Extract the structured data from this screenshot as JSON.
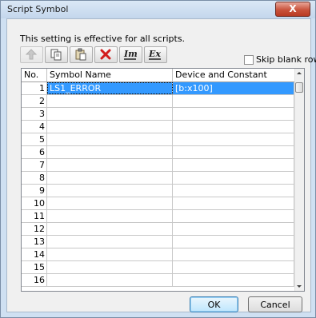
{
  "window": {
    "title": "Script Symbol",
    "close_glyph": "X"
  },
  "hint": "This setting is effective for all scripts.",
  "toolbar": {
    "buttons": [
      {
        "name": "add-row-icon",
        "enabled": false
      },
      {
        "name": "copy-icon",
        "enabled": true
      },
      {
        "name": "paste-icon",
        "enabled": true
      },
      {
        "name": "delete-icon",
        "enabled": true
      },
      {
        "name": "import-icon",
        "enabled": true
      },
      {
        "name": "export-icon",
        "enabled": true
      }
    ]
  },
  "skip_blank_rows": {
    "label": "Skip blank rows",
    "checked": false
  },
  "table": {
    "columns": [
      "No.",
      "Symbol Name",
      "Device and Constant"
    ],
    "rows": [
      {
        "no": "1",
        "symbol": "LS1_ERROR",
        "device": "[b:x100]"
      },
      {
        "no": "2",
        "symbol": "",
        "device": ""
      },
      {
        "no": "3",
        "symbol": "",
        "device": ""
      },
      {
        "no": "4",
        "symbol": "",
        "device": ""
      },
      {
        "no": "5",
        "symbol": "",
        "device": ""
      },
      {
        "no": "6",
        "symbol": "",
        "device": ""
      },
      {
        "no": "7",
        "symbol": "",
        "device": ""
      },
      {
        "no": "8",
        "symbol": "",
        "device": ""
      },
      {
        "no": "9",
        "symbol": "",
        "device": ""
      },
      {
        "no": "10",
        "symbol": "",
        "device": ""
      },
      {
        "no": "11",
        "symbol": "",
        "device": ""
      },
      {
        "no": "12",
        "symbol": "",
        "device": ""
      },
      {
        "no": "13",
        "symbol": "",
        "device": ""
      },
      {
        "no": "14",
        "symbol": "",
        "device": ""
      },
      {
        "no": "15",
        "symbol": "",
        "device": ""
      },
      {
        "no": "16",
        "symbol": "",
        "device": ""
      }
    ]
  },
  "buttons": {
    "ok": "OK",
    "cancel": "Cancel"
  },
  "colors": {
    "selection": "#3399ff",
    "close": "#c9533c"
  }
}
